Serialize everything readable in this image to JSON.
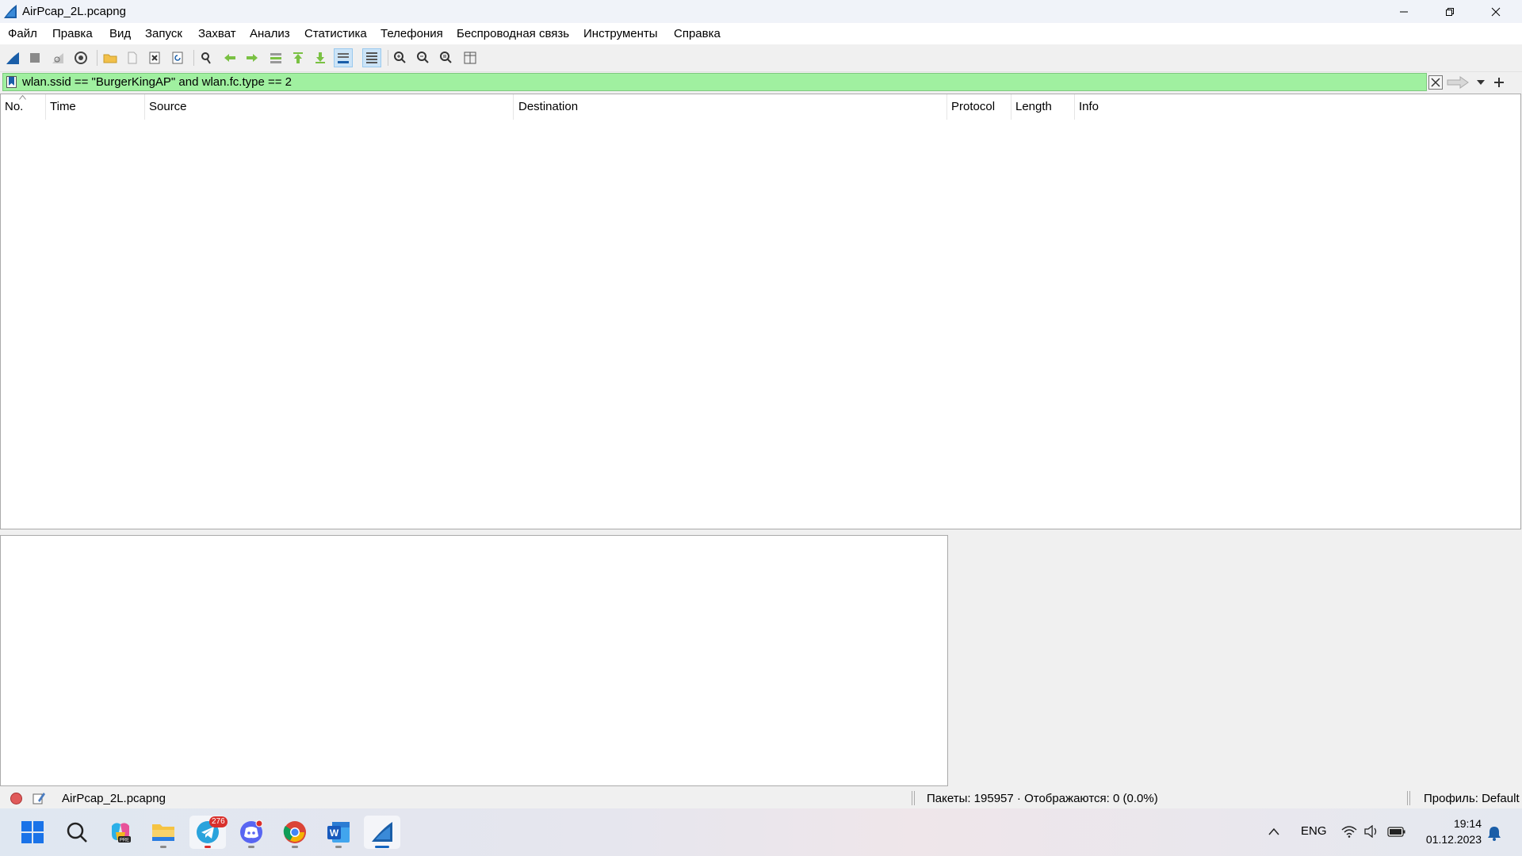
{
  "window": {
    "title": "AirPcap_2L.pcapng"
  },
  "menu": [
    "Файл",
    "Правка",
    "Вид",
    "Запуск",
    "Захват",
    "Анализ",
    "Статистика",
    "Телефония",
    "Беспроводная связь",
    "Инструменты",
    "Справка"
  ],
  "filter": {
    "value": "wlan.ssid == \"BurgerKingAP\" and wlan.fc.type == 2"
  },
  "columns": [
    "No.",
    "Time",
    "Source",
    "Destination",
    "Protocol",
    "Length",
    "Info"
  ],
  "status": {
    "file": "AirPcap_2L.pcapng",
    "packets": "Пакеты: 195957 · Отображаются: 0 (0.0%)",
    "profile": "Профиль: Default"
  },
  "taskbar": {
    "telegram_badge": "276",
    "language": "ENG",
    "time": "19:14",
    "date": "01.12.2023"
  },
  "colors": {
    "filter_valid": "#a0f0a0",
    "accent": "#1565c0"
  }
}
